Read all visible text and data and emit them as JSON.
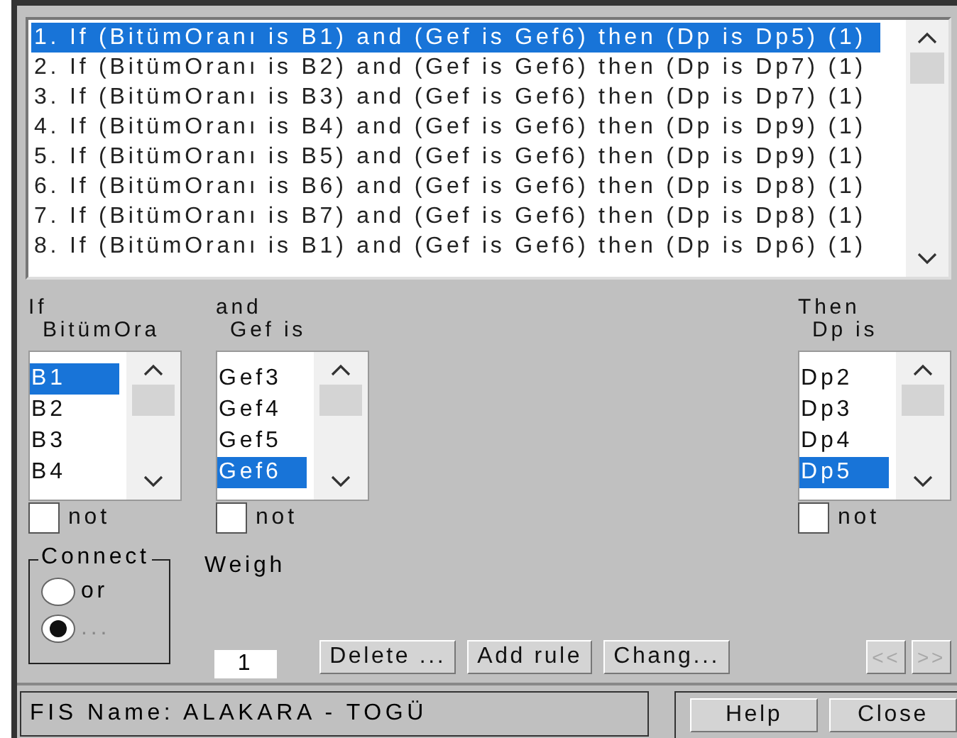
{
  "rules": [
    {
      "text": "1. If (BitümOranı is B1) and (Gef is Gef6) then (Dp is Dp5) (1)",
      "selected": true
    },
    {
      "text": "2. If (BitümOranı is B2) and (Gef is Gef6) then (Dp is Dp7) (1)",
      "selected": false
    },
    {
      "text": "3. If (BitümOranı is B3) and (Gef is Gef6) then (Dp is Dp7) (1)",
      "selected": false
    },
    {
      "text": "4. If (BitümOranı is B4) and (Gef is Gef6) then (Dp is Dp9) (1)",
      "selected": false
    },
    {
      "text": "5. If (BitümOranı is B5) and (Gef is Gef6) then (Dp is Dp9) (1)",
      "selected": false
    },
    {
      "text": "6. If (BitümOranı is B6) and (Gef is Gef6) then (Dp is Dp8) (1)",
      "selected": false
    },
    {
      "text": "7. If (BitümOranı is B7) and (Gef is Gef6) then (Dp is Dp8) (1)",
      "selected": false
    },
    {
      "text": "8. If (BitümOranı is B1) and (Gef is Gef6) then (Dp is Dp6) (1)",
      "selected": false
    }
  ],
  "if_inputs": [
    {
      "heading": "If",
      "label": "BitümOra",
      "items": [
        {
          "text": "B1",
          "selected": true
        },
        {
          "text": "B2",
          "selected": false
        },
        {
          "text": "B3",
          "selected": false
        },
        {
          "text": "B4",
          "selected": false
        }
      ],
      "not": {
        "label": "not",
        "checked": false
      }
    },
    {
      "heading": "and",
      "label": "Gef is",
      "items": [
        {
          "text": "Gef3",
          "selected": false
        },
        {
          "text": "Gef4",
          "selected": false
        },
        {
          "text": "Gef5",
          "selected": false
        },
        {
          "text": "Gef6",
          "selected": true
        }
      ],
      "not": {
        "label": "not",
        "checked": false
      }
    }
  ],
  "then_outputs": [
    {
      "heading": "Then",
      "label": "Dp is",
      "items": [
        {
          "text": "Dp2",
          "selected": false
        },
        {
          "text": "Dp3",
          "selected": false
        },
        {
          "text": "Dp4",
          "selected": false
        },
        {
          "text": "Dp5",
          "selected": true
        }
      ],
      "not": {
        "label": "not",
        "checked": false
      }
    }
  ],
  "connection": {
    "label": "Connect",
    "options": [
      {
        "label": "or",
        "selected": false
      },
      {
        "label": "...",
        "selected": true
      }
    ]
  },
  "weight": {
    "label": "Weigh",
    "value": "1"
  },
  "buttons": [
    {
      "label": "Delete ...",
      "disabled": false
    },
    {
      "label": "Add rule",
      "disabled": false
    },
    {
      "label": "Chang...",
      "disabled": false
    }
  ],
  "nav_buttons": [
    {
      "label": "<<",
      "disabled": true
    },
    {
      "label": ">>",
      "disabled": true
    }
  ],
  "status": {
    "text": "FIS Name: ALAKARA - TOGÜ"
  },
  "footer_buttons": [
    {
      "label": "Help"
    },
    {
      "label": "Close"
    }
  ]
}
